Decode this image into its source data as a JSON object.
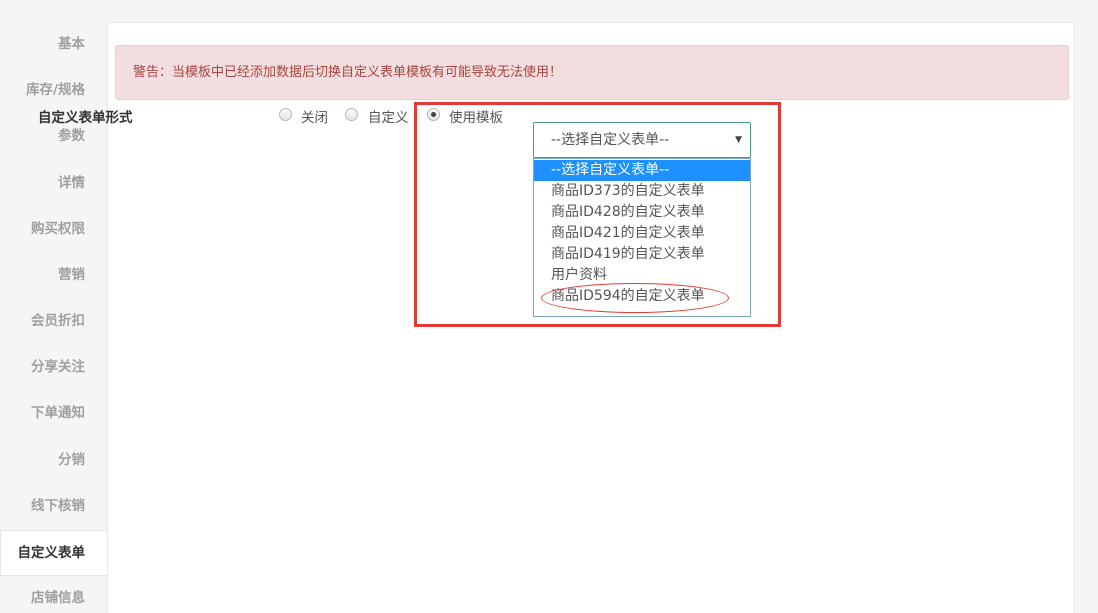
{
  "sidebar": {
    "items": [
      {
        "label": "基本"
      },
      {
        "label": "库存/规格"
      },
      {
        "label": "参数"
      },
      {
        "label": "详情"
      },
      {
        "label": "购买权限"
      },
      {
        "label": "营销"
      },
      {
        "label": "会员折扣"
      },
      {
        "label": "分享关注"
      },
      {
        "label": "下单通知"
      },
      {
        "label": "分销"
      },
      {
        "label": "线下核销"
      },
      {
        "label": "自定义表单"
      },
      {
        "label": "店铺信息"
      }
    ],
    "active_index": 11
  },
  "alert": {
    "text": "警告：当模板中已经添加数据后切换自定义表单模板有可能导致无法使用！"
  },
  "form": {
    "label": "自定义表单形式",
    "radios": [
      {
        "label": "关闭",
        "checked": false
      },
      {
        "label": "自定义",
        "checked": false
      },
      {
        "label": "使用模板",
        "checked": true
      }
    ],
    "select": {
      "value": "--选择自定义表单--",
      "caret": "▼",
      "options": [
        {
          "label": "--选择自定义表单--"
        },
        {
          "label": "商品ID373的自定义表单"
        },
        {
          "label": "商品ID428的自定义表单"
        },
        {
          "label": "商品ID421的自定义表单"
        },
        {
          "label": "商品ID419的自定义表单"
        },
        {
          "label": "用户资料"
        },
        {
          "label": "商品ID594的自定义表单"
        }
      ],
      "highlighted_index": 0
    }
  },
  "colors": {
    "annotation": "#e53935",
    "selected_option_bg": "#1e90ff",
    "alert_bg": "#f2dede",
    "alert_text": "#a94442"
  }
}
